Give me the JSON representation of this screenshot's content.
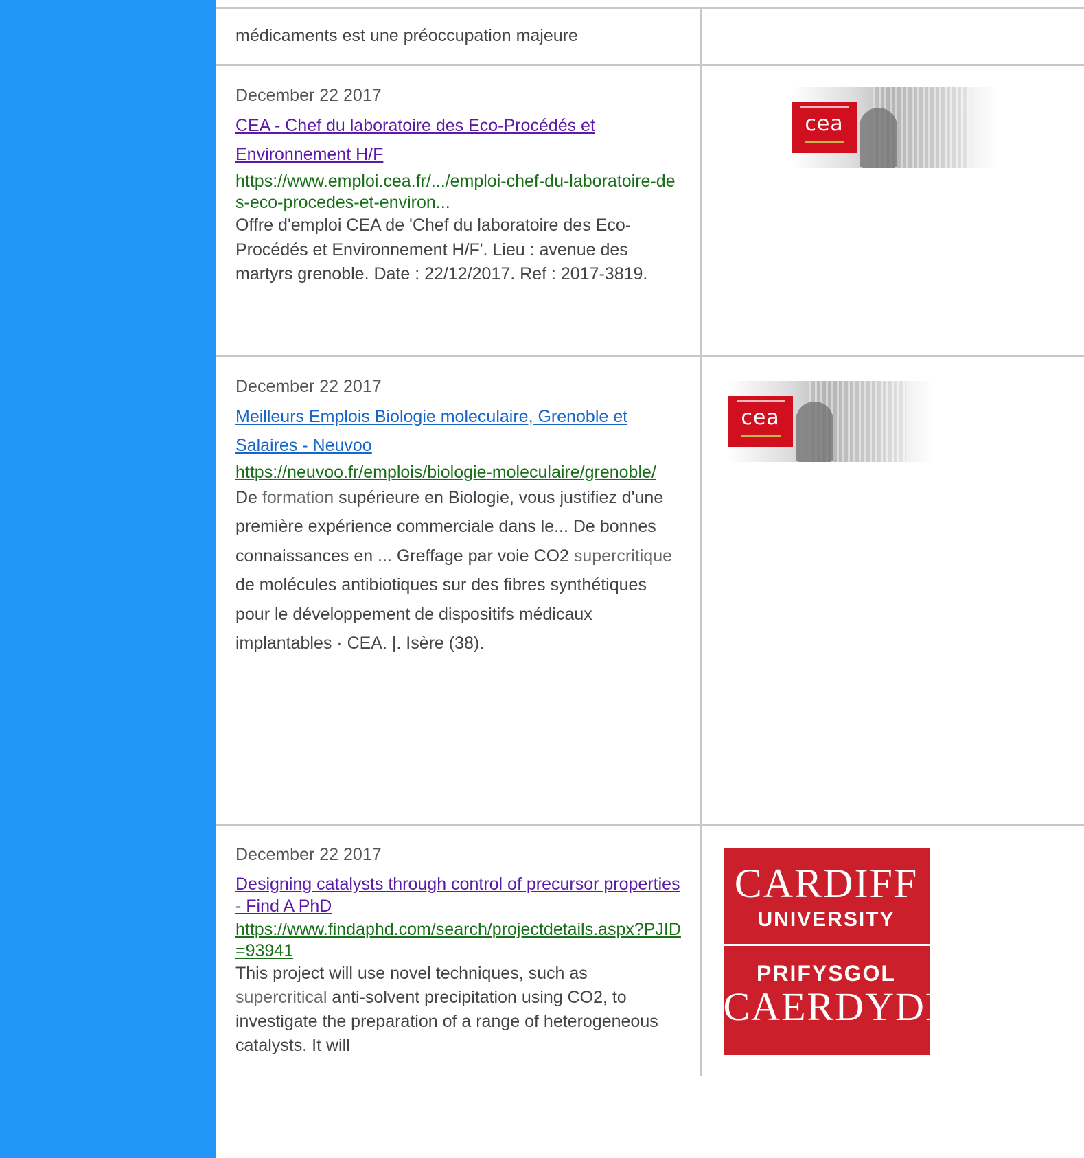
{
  "rows": [
    {
      "snippet": "médicaments est une préoccupation majeure"
    },
    {
      "date": "December 22  2017",
      "title": "CEA - Chef du laboratoire des Eco-Procédés et Environnement H/F",
      "url": "https://www.emploi.cea.fr/.../emploi-chef-du-laboratoire-des-eco-procedes-et-environ...",
      "snippet": "Offre d'emploi CEA de 'Chef du laboratoire des Eco-Procédés et Environnement H/F'. Lieu : avenue des martyrs grenoble. Date : 22/12/2017. Ref : 2017-3819.",
      "logo_text": "cea"
    },
    {
      "date": "December 22 2017",
      "title": "Meilleurs Emplois Biologie moleculaire, Grenoble et Salaires - Neuvoo",
      "url": "https://neuvoo.fr/emplois/biologie-moleculaire/grenoble/",
      "snippet_a": "De ",
      "snippet_hl1": "formation",
      "snippet_b": " supérieure en Biologie, vous justifiez d'une première expérience commerciale dans le... De bonnes connaissances en ... Greffage par voie CO2 ",
      "snippet_hl2": "supercritique",
      "snippet_c": " de molécules antibiotiques sur des fibres synthétiques pour le développement de dispositifs médicaux implantables · CEA. |. Isère (38).",
      "logo_text": "cea"
    },
    {
      "date": "December 22 2017",
      "title": "Designing catalysts through control of precursor properties - Find A PhD",
      "url": "https://www.findaphd.com/search/projectdetails.aspx?PJID=93941",
      "snippet_a": "This project will use novel techniques, such as ",
      "snippet_hl": "supercritical",
      "snippet_b": " anti-solvent precipitation using CO2, to investigate the preparation of a range of heterogeneous catalysts. It will",
      "logo": {
        "line1": "CARDIFF",
        "line2": "UNIVERSITY",
        "line3": "PRIFYSGOL",
        "line4": "CAERDYDD"
      }
    }
  ],
  "colors": {
    "sidebar": "#2196f8",
    "visited_link": "#5c1aa8",
    "link": "#1765c9",
    "url": "#186f18",
    "cardiff_red": "#cc1f2c",
    "cea_red": "#d0101e"
  }
}
